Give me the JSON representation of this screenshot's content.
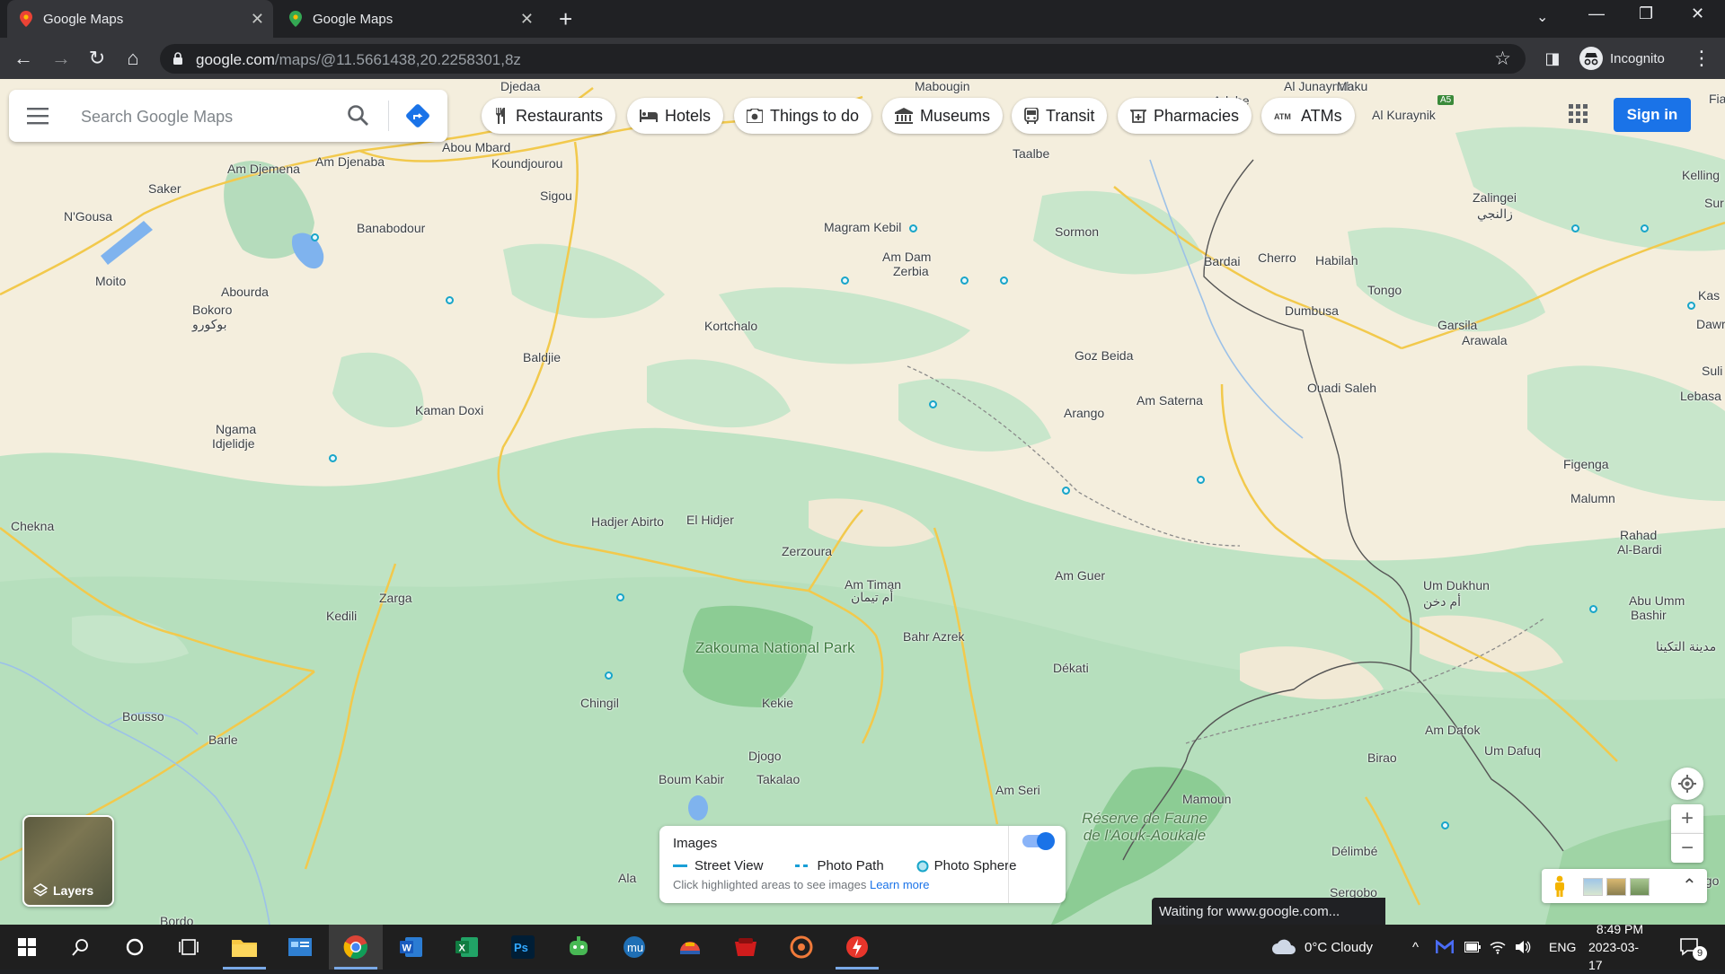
{
  "browser": {
    "tabs": [
      {
        "title": "Google Maps",
        "active": true
      },
      {
        "title": "Google Maps",
        "active": false
      }
    ],
    "url_host": "google.com",
    "url_path": "/maps/@11.5661438,20.2258301,8z",
    "profile_label": "Incognito"
  },
  "maps": {
    "search_placeholder": "Search Google Maps",
    "chips": [
      "Restaurants",
      "Hotels",
      "Things to do",
      "Museums",
      "Transit",
      "Pharmacies",
      "ATMs"
    ],
    "sign_in": "Sign in",
    "layers_label": "Layers",
    "images_panel": {
      "title": "Images",
      "street_view": "Street View",
      "photo_path": "Photo Path",
      "photo_sphere": "Photo Sphere",
      "hint": "Click highlighted areas to see images",
      "learn_more": "Learn more",
      "toggle_on": true
    },
    "status_text": "Waiting for www.google.com...",
    "places": [
      "Djedaa",
      "Abou Mbard",
      "Koundjourou",
      "Am Djemena",
      "Am Djenaba",
      "Saker",
      "Sigou",
      "N'Gousa",
      "Banabodour",
      "Moito",
      "Abourda",
      "Bokoro",
      "بوكورو",
      "Kortchalo",
      "Baldjie",
      "Kaman Doxi",
      "Ngama",
      "Idjelidje",
      "Chekna",
      "Hadjer Abirto",
      "El Hidjer",
      "Zerzoura",
      "Am Timan",
      "أم تيمان",
      "Bahr Azrek",
      "Zarga",
      "Kedili",
      "Chingil",
      "Kekie",
      "Bousso",
      "Barle",
      "Djogo",
      "Boum Kabir",
      "Takalao",
      "Ala",
      "Bordo",
      "Magram Kebil",
      "Am Dam",
      "Zerbia",
      "Sormon",
      "Taalbe",
      "Mabougin",
      "Adebe",
      "Al Junaynah",
      "Maku",
      "Al Kuraynik",
      "Bardai",
      "Cherro",
      "Habilah",
      "Tongo",
      "Dumbusa",
      "Goz Beida",
      "Arango",
      "Am Saterna",
      "Ouadi Saleh",
      "Garsila",
      "Arawala",
      "Zalingei",
      "زالنجي",
      "Kelling",
      "Sur",
      "Fiab",
      "Kas",
      "Dawrah",
      "Suli",
      "Lebasa",
      "Figenga",
      "Malumn",
      "Rahad",
      "Al-Bardi",
      "Um Dukhun",
      "أم دخن",
      "Abu Umm",
      "Bashir",
      "مدينة التكينا",
      "Am Guer",
      "Dékati",
      "Am Dafok",
      "Um Dafuq",
      "Birao",
      "Mamoun",
      "Am Seri",
      "Délimbé",
      "Sergobo",
      "ngo",
      "A5"
    ],
    "park_name": "Zakouma National Park",
    "reserve_name": "Réserve de Faune de l'Aouk-Aoukale"
  },
  "taskbar": {
    "weather": "0°C  Cloudy",
    "language": "ENG",
    "time": "8:49 PM",
    "date": "2023-03-17",
    "notifications": "9"
  },
  "colors": {
    "map_base": "#f4eedd",
    "map_green": "#bfe3c4",
    "park_green": "#8ccc94",
    "road_yellow": "#f2c94c",
    "accent_blue": "#1a73e8"
  }
}
